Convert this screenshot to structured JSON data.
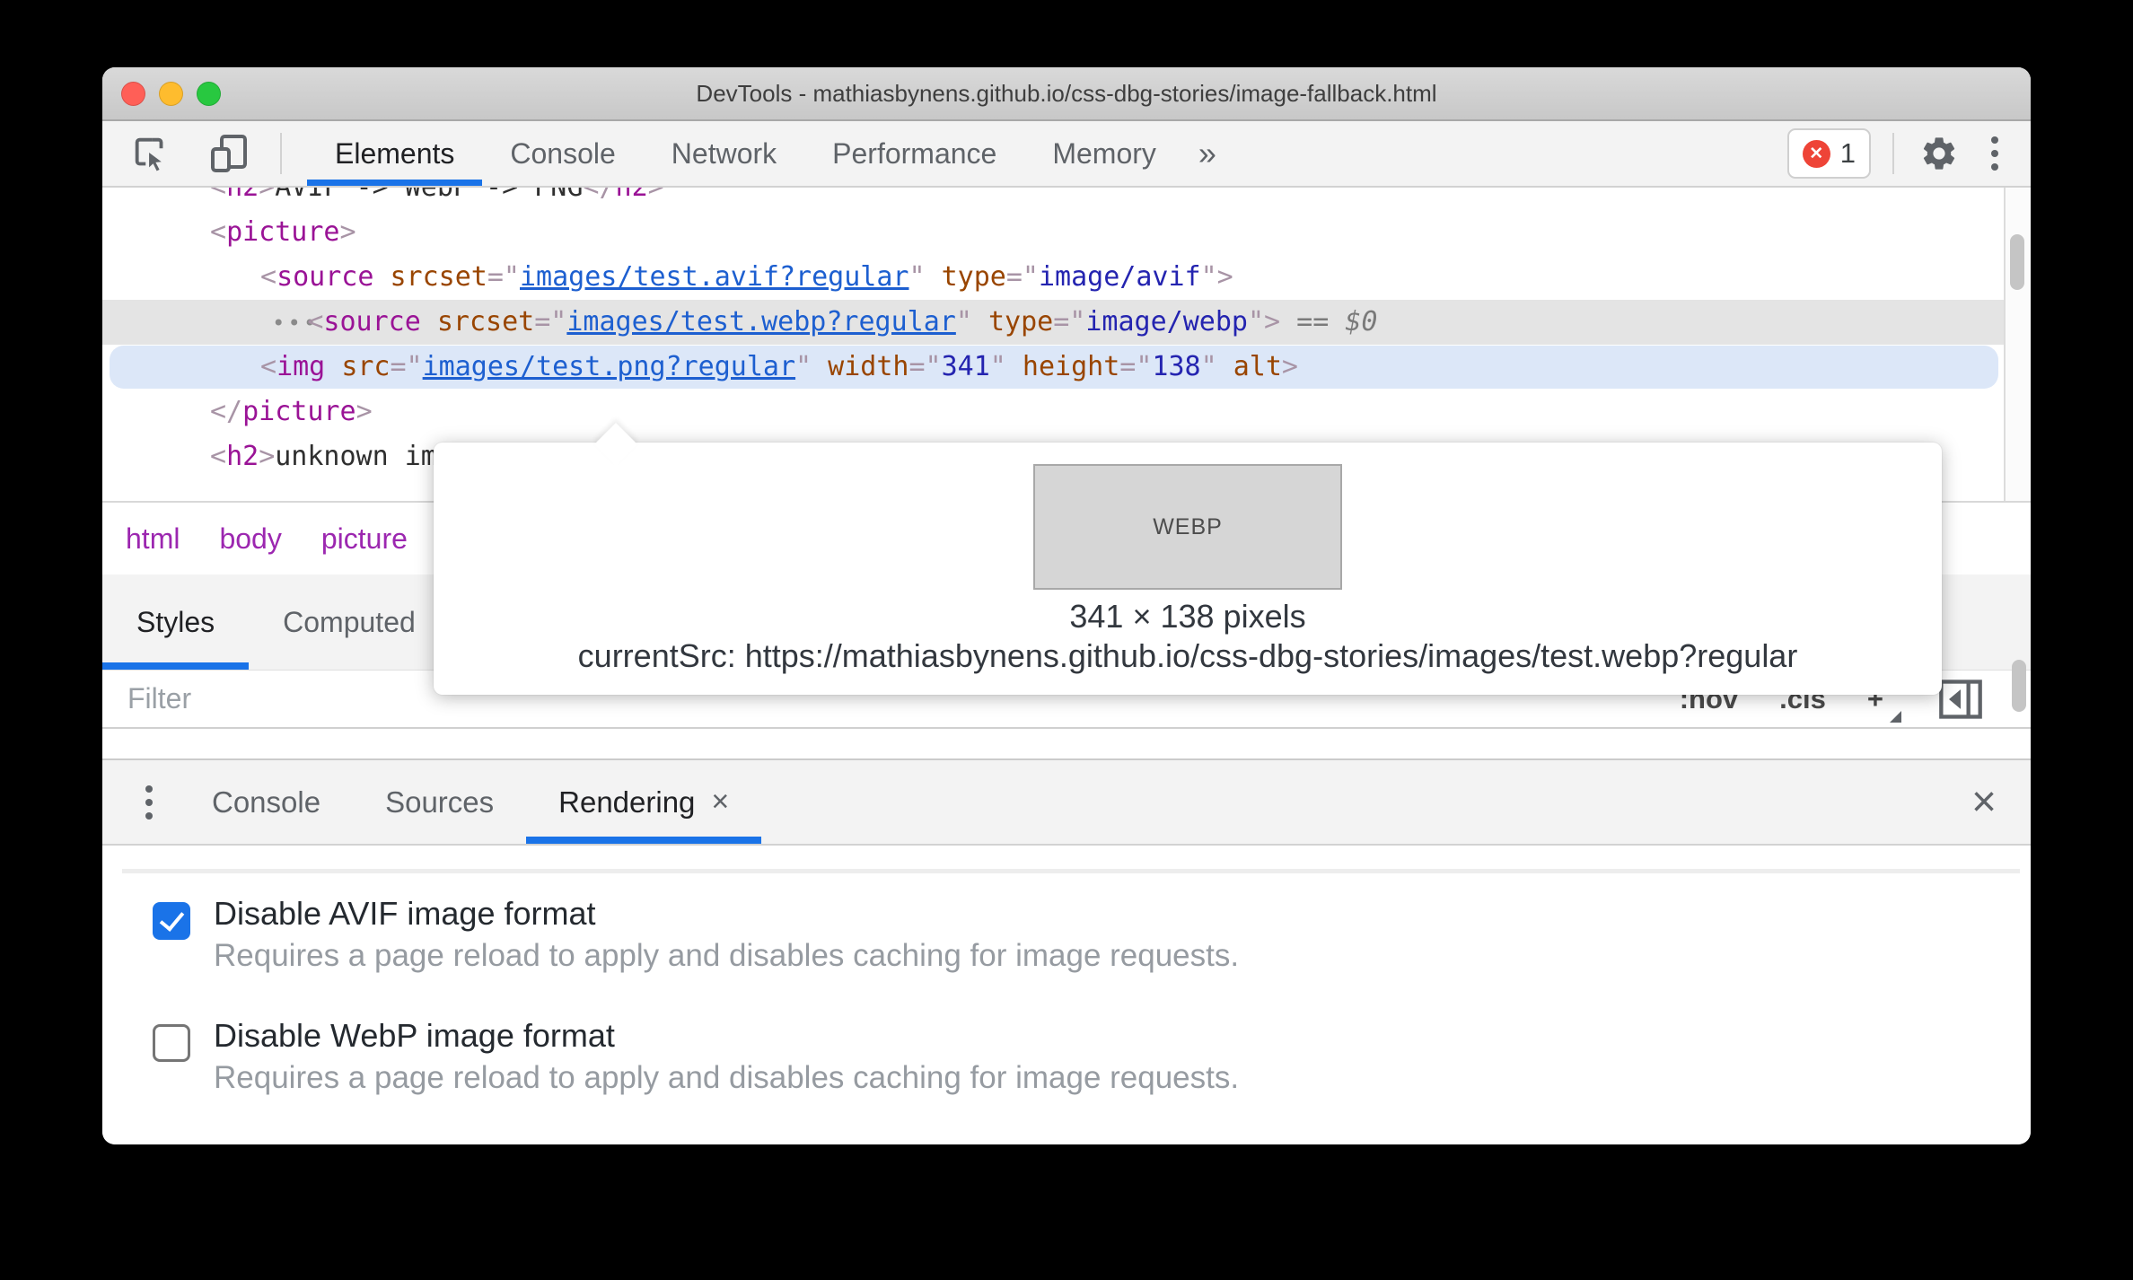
{
  "window": {
    "title": "DevTools - mathiasbynens.github.io/css-dbg-stories/image-fallback.html"
  },
  "toolbar": {
    "tabs": [
      "Elements",
      "Console",
      "Network",
      "Performance",
      "Memory"
    ],
    "active_tab": "Elements",
    "overflow_icon": "»",
    "error_count": "1",
    "error_icon": "✕"
  },
  "elements_panel": {
    "gutter_dots": "•••",
    "lines": [
      {
        "indent": 0,
        "clipped": true,
        "tokens": [
          {
            "c": "p",
            "s": "<"
          },
          {
            "c": "tag",
            "s": "h2"
          },
          {
            "c": "p",
            "s": ">"
          },
          {
            "c": "txt",
            "s": "AVIF -> WebP -> PNG"
          },
          {
            "c": "p",
            "s": "</"
          },
          {
            "c": "tag",
            "s": "h2"
          },
          {
            "c": "p",
            "s": ">"
          }
        ]
      },
      {
        "indent": 0,
        "tokens": [
          {
            "c": "p",
            "s": "<"
          },
          {
            "c": "tag",
            "s": "picture"
          },
          {
            "c": "p",
            "s": ">"
          }
        ]
      },
      {
        "indent": 1,
        "tokens": [
          {
            "c": "p",
            "s": "<"
          },
          {
            "c": "tag",
            "s": "source"
          },
          {
            "c": "txt",
            "s": " "
          },
          {
            "c": "attr",
            "s": "srcset"
          },
          {
            "c": "p",
            "s": "=\""
          },
          {
            "c": "link",
            "s": "images/test.avif?regular"
          },
          {
            "c": "p",
            "s": "\""
          },
          {
            "c": "txt",
            "s": " "
          },
          {
            "c": "attr",
            "s": "type"
          },
          {
            "c": "p",
            "s": "=\""
          },
          {
            "c": "str",
            "s": "image/avif"
          },
          {
            "c": "p",
            "s": "\""
          },
          {
            "c": "p",
            "s": ">"
          }
        ]
      },
      {
        "indent": 1,
        "state": "hover",
        "gutter": true,
        "tokens": [
          {
            "c": "p",
            "s": "<"
          },
          {
            "c": "tag",
            "s": "source"
          },
          {
            "c": "txt",
            "s": " "
          },
          {
            "c": "attr",
            "s": "srcset"
          },
          {
            "c": "p",
            "s": "=\""
          },
          {
            "c": "link",
            "s": "images/test.webp?regular"
          },
          {
            "c": "p",
            "s": "\""
          },
          {
            "c": "txt",
            "s": " "
          },
          {
            "c": "attr",
            "s": "type"
          },
          {
            "c": "p",
            "s": "=\""
          },
          {
            "c": "str",
            "s": "image/webp"
          },
          {
            "c": "p",
            "s": "\""
          },
          {
            "c": "p",
            "s": ">"
          },
          {
            "c": "anno",
            "s": " == $0"
          }
        ]
      },
      {
        "indent": 1,
        "state": "selected",
        "tokens": [
          {
            "c": "p",
            "s": "<"
          },
          {
            "c": "tag",
            "s": "img"
          },
          {
            "c": "txt",
            "s": " "
          },
          {
            "c": "attr",
            "s": "src"
          },
          {
            "c": "p",
            "s": "=\""
          },
          {
            "c": "link",
            "s": "images/test.png?regular"
          },
          {
            "c": "p",
            "s": "\""
          },
          {
            "c": "txt",
            "s": " "
          },
          {
            "c": "attr",
            "s": "width"
          },
          {
            "c": "p",
            "s": "=\""
          },
          {
            "c": "str",
            "s": "341"
          },
          {
            "c": "p",
            "s": "\""
          },
          {
            "c": "txt",
            "s": " "
          },
          {
            "c": "attr",
            "s": "height"
          },
          {
            "c": "p",
            "s": "=\""
          },
          {
            "c": "str",
            "s": "138"
          },
          {
            "c": "p",
            "s": "\""
          },
          {
            "c": "txt",
            "s": " "
          },
          {
            "c": "attr",
            "s": "alt"
          },
          {
            "c": "p",
            "s": ">"
          }
        ]
      },
      {
        "indent": 0,
        "tokens": [
          {
            "c": "p",
            "s": "</"
          },
          {
            "c": "tag",
            "s": "picture"
          },
          {
            "c": "p",
            "s": ">"
          }
        ]
      },
      {
        "indent": 0,
        "tokens": [
          {
            "c": "p",
            "s": "<"
          },
          {
            "c": "tag",
            "s": "h2"
          },
          {
            "c": "p",
            "s": ">"
          },
          {
            "c": "txt",
            "s": "unknown image format"
          },
          {
            "c": "p",
            "s": "</"
          },
          {
            "c": "tag",
            "s": "h2"
          },
          {
            "c": "p",
            "s": ">"
          }
        ]
      }
    ]
  },
  "breadcrumb": {
    "items": [
      "html",
      "body",
      "picture"
    ]
  },
  "styles_sidebar": {
    "tabs": [
      "Styles",
      "Computed"
    ],
    "active_tab": "Styles",
    "filter_placeholder": "Filter",
    "toolbar_buttons": [
      ":hov",
      ".cls",
      "+"
    ]
  },
  "tooltip": {
    "image_label": "WEBP",
    "dimensions": "341 × 138 pixels",
    "current_src": "currentSrc: https://mathiasbynens.github.io/css-dbg-stories/images/test.webp?regular"
  },
  "drawer": {
    "tabs": [
      {
        "label": "Console"
      },
      {
        "label": "Sources"
      },
      {
        "label": "Rendering",
        "active": true,
        "close_label": "×"
      }
    ],
    "close_label": "×"
  },
  "rendering_panel": {
    "checkboxes": [
      {
        "label": "Disable AVIF image format",
        "description": "Requires a page reload to apply and disables caching for image requests.",
        "checked": true
      },
      {
        "label": "Disable WebP image format",
        "description": "Requires a page reload to apply and disables caching for image requests.",
        "checked": false
      }
    ]
  },
  "colors": {
    "accent_blue": "#1a73e8",
    "error_red": "#ee4437",
    "selected_row": "#dce7f8",
    "hover_row": "#e4e4e4",
    "tag": "#9a1396",
    "attribute": "#994500",
    "value": "#2424b0",
    "link": "#1d5fd0",
    "breadcrumb": "#9c27b0"
  }
}
